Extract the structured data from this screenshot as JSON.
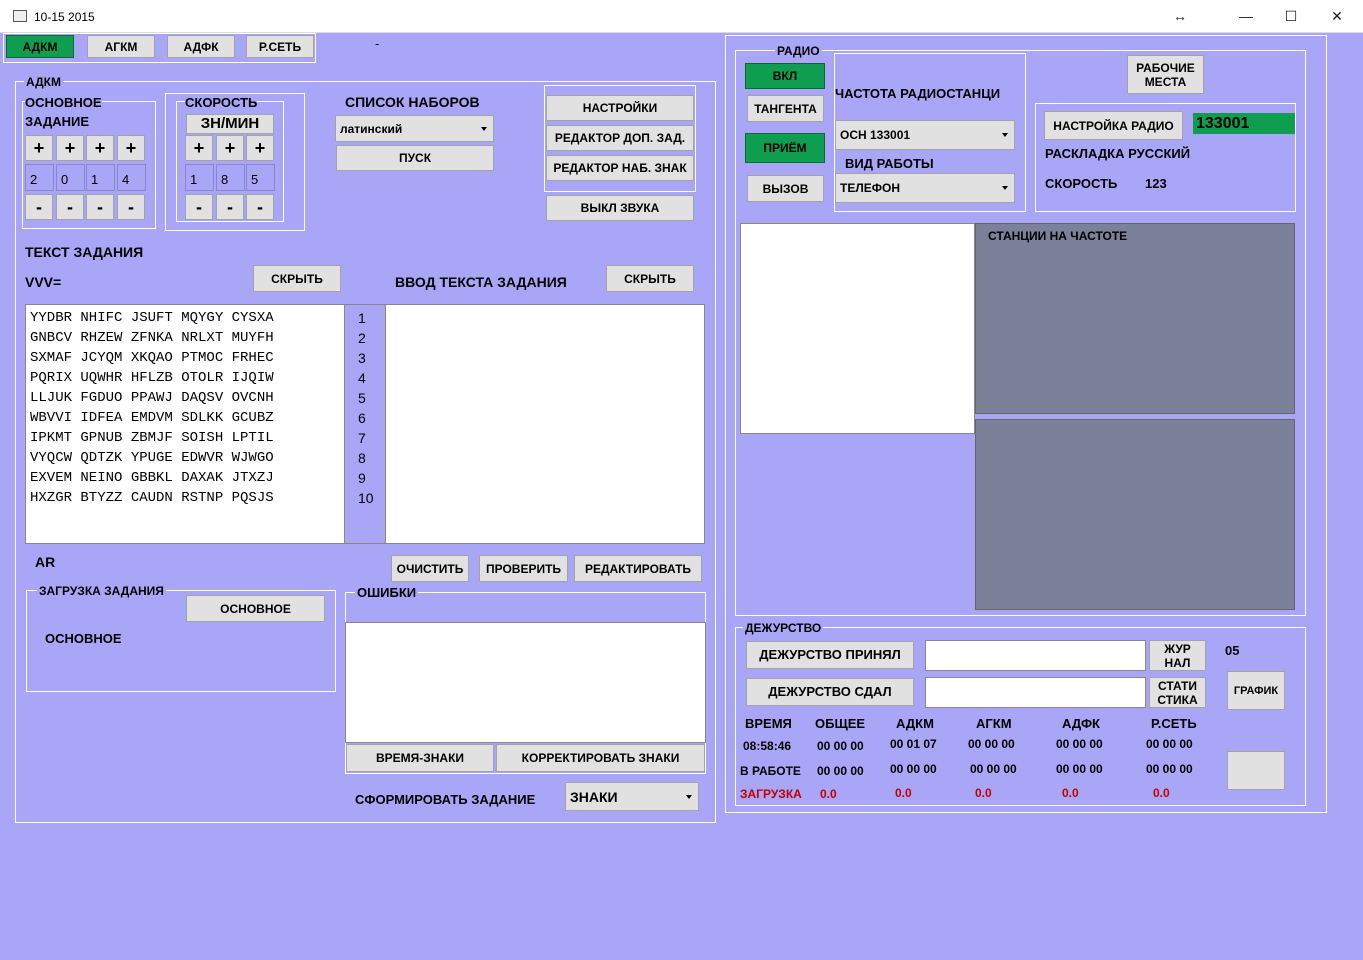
{
  "window": {
    "title": "10-15 2015"
  },
  "tabs": [
    "АДКМ",
    "АГКМ",
    "АДФК",
    "Р.СЕТЬ"
  ],
  "tab_extra": "-",
  "adkm": {
    "group_title": "АДКМ",
    "main_task_title_line1": "ОСНОВНОЕ",
    "main_task_title_line2": "ЗАДАНИЕ",
    "main_task_values": [
      "2",
      "0",
      "1",
      "4"
    ],
    "speed_title": "СКОРОСТЬ",
    "speed_unit": "ЗН/МИН",
    "speed_values": [
      "1",
      "8",
      "5"
    ],
    "plus": "+",
    "minus": "-",
    "sets_title": "СПИСОК  НАБОРОВ",
    "sets_selected": "латинский",
    "start_button": "ПУСК",
    "settings_button": "НАСТРОЙКИ",
    "editor_extra_button": "РЕДАКТОР ДОП. ЗАД.",
    "editor_set_button": "РЕДАКТОР НАБ. ЗНАК",
    "sound_off_button": "ВЫКЛ  ЗВУКА",
    "task_text_title": "ТЕКСТ ЗАДАНИЯ",
    "vvv_label": "VVV=",
    "hide_button_1": "СКРЫТЬ",
    "input_title": "ВВОД ТЕКСТА ЗАДАНИЯ",
    "hide_button_2": "СКРЫТЬ",
    "task_lines": [
      "YYDBR NHIFC JSUFT MQYGY CYSXA",
      "GNBCV RHZEW ZFNKA NRLXT MUYFH",
      "SXMAF JCYQM XKQAO PTMOC FRHEC",
      "PQRIX UQWHR HFLZB OTOLR IJQIW",
      "LLJUK FGDUO PPAWJ DAQSV OVCNH",
      "WBVVI IDFEA EMDVM SDLKK GCUBZ",
      "IPKMT GPNUB ZBMJF SOISH LPTIL",
      "VYQCW QDTZK YPUGE EDWVR WJWGO",
      "EXVEM NEINO GBBKL DAXAK JTXZJ",
      "HXZGR BTYZZ CAUDN RSTNP PQSJS"
    ],
    "line_numbers": [
      "1",
      "2",
      "3",
      "4",
      "5",
      "6",
      "7",
      "8",
      "9",
      "10"
    ],
    "ar_label": "AR",
    "clear_button": "ОЧИСТИТЬ",
    "check_button": "ПРОВЕРИТЬ",
    "edit_button": "РЕДАКТИРОВАТЬ",
    "load_title": "ЗАГРУЗКА ЗАДАНИЯ",
    "load_button": "ОСНОВНОЕ",
    "load_value": "ОСНОВНОЕ",
    "errors_title": "ОШИБКИ",
    "time_signs_button": "ВРЕМЯ-ЗНАКИ",
    "correct_signs_button": "КОРРЕКТИРОВАТЬ ЗНАКИ",
    "form_task_label": "СФОРМИРОВАТЬ ЗАДАНИЕ",
    "form_task_selected": "ЗНАКИ"
  },
  "radio": {
    "title": "РАДИО",
    "on_button": "ВКЛ",
    "tangent_button": "ТАНГЕНТА",
    "receive_button": "ПРИЁМ",
    "call_button": "ВЫЗОВ",
    "freq_title": "ЧАСТОТА РАДИОСТАНЦИ",
    "freq_selected": "ОСН 133001",
    "mode_title": "ВИД РАБОТЫ",
    "mode_selected": "ТЕЛЕФОН",
    "workplaces_button_l1": "РАБОЧИЕ",
    "workplaces_button_l2": "МЕСТА",
    "radio_setup_button": "НАСТРОЙКА  РАДИО",
    "radio_freq_value": "133001",
    "layout_label": "РАСКЛАДКА  РУССКИЙ",
    "speed_label": "СКОРОСТЬ",
    "speed_value": "123",
    "stations_title": "СТАНЦИИ НА ЧАСТОТЕ"
  },
  "duty": {
    "title": "ДЕЖУРСТВО",
    "accepted_button": "ДЕЖУРСТВО ПРИНЯЛ",
    "handed_button": "ДЕЖУРСТВО  СДАЛ",
    "journal_l1": "ЖУР",
    "journal_l2": "НАЛ",
    "stats_l1": "СТАТИ",
    "stats_l2": "СТИКА",
    "counter": "05",
    "schedule_button": "ГРАФИК",
    "headers": [
      "ВРЕМЯ",
      "ОБЩЕЕ",
      "АДКМ",
      "АГКМ",
      "АДФК",
      "Р.СЕТЬ"
    ],
    "row_time": [
      "08:58:46",
      "00 00 00",
      "00 01 07",
      "00 00 00",
      "00 00 00",
      "00 00 00"
    ],
    "row_work": [
      "В РАБОТЕ",
      "00 00 00",
      "00 00 00",
      "00 00 00",
      "00 00 00",
      "00 00 00"
    ],
    "row_load": [
      "ЗАГРУЗКА",
      "0.0",
      "0.0",
      "0.0",
      "0.0",
      "0.0"
    ]
  },
  "colors": {
    "background": "#aaa6f7",
    "active_green": "#0f9e4f",
    "panel_gray": "#7a8199",
    "load_red": "#c00000"
  }
}
